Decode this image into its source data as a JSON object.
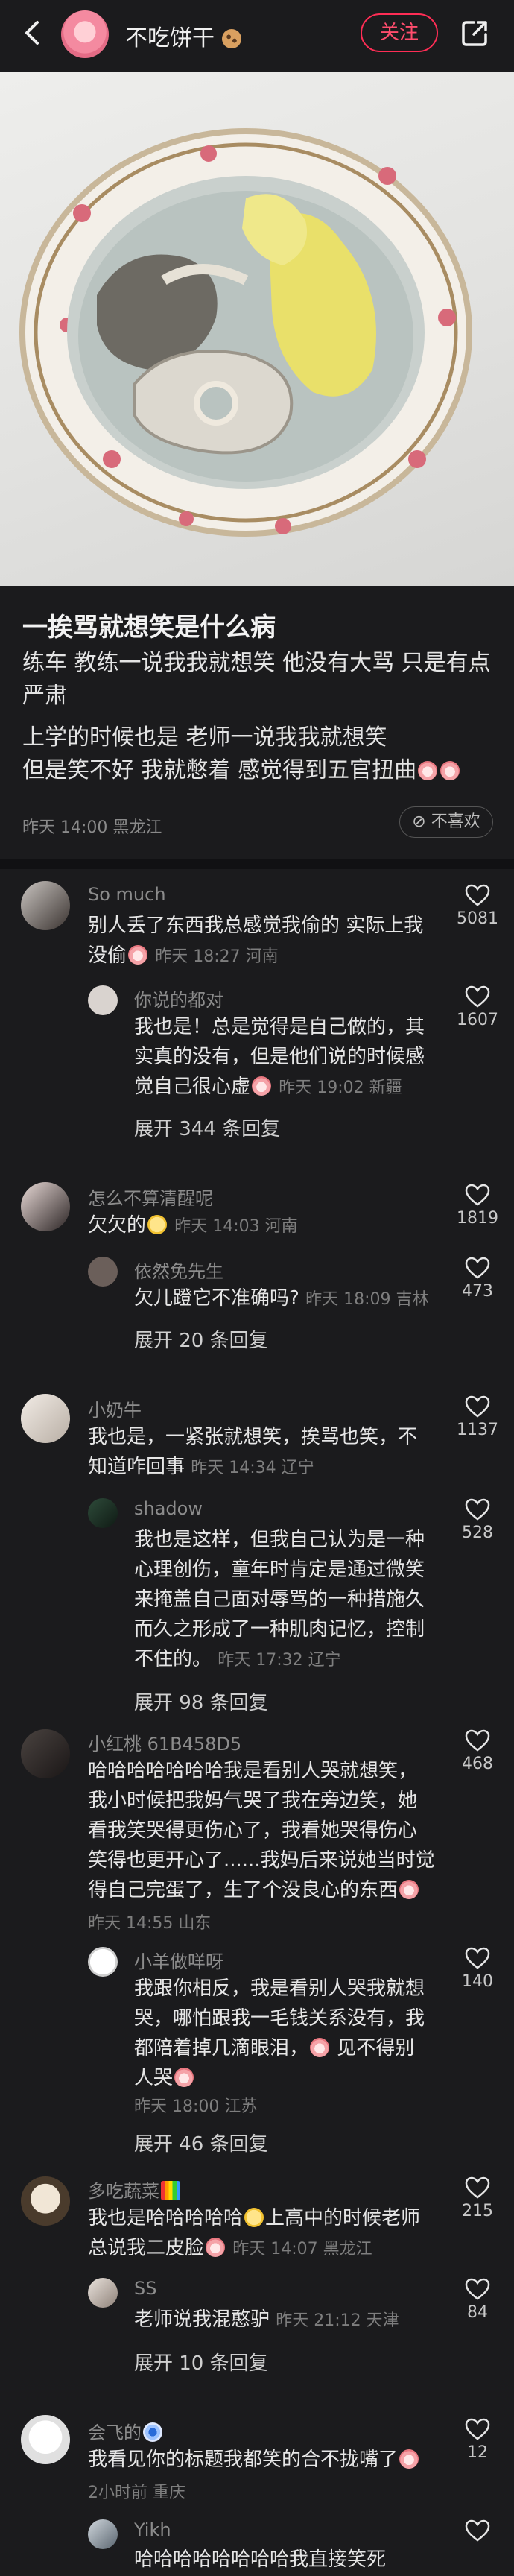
{
  "author": {
    "name": "不吃饼干"
  },
  "header": {
    "follow_label": "关注"
  },
  "post": {
    "title": "一挨骂就想笑是什么病",
    "lines": [
      "练车 教练一说我我就想笑 他没有大骂 只是有点",
      "严肃",
      "上学的时候也是 老师一说我我就想笑",
      "但是笑不好 我就憋着 感觉得到五官扭曲"
    ],
    "meta": "昨天 14:00 黑龙江",
    "dislike_label": "不喜欢"
  },
  "comments": [
    {
      "user": "So much",
      "lines": [
        "别人丢了东西我总感觉我偷的 实际上我",
        "没偷"
      ],
      "meta": "昨天 18:27 河南",
      "likes": "5081",
      "reply": {
        "user": "你说的都对",
        "lines": [
          "我也是！总是觉得是自己做的，其",
          "实真的没有，但是他们说的时候感",
          "觉自己很心虚"
        ],
        "meta": "昨天 19:02 新疆",
        "likes": "1607"
      },
      "expand": "展开 344 条回复"
    },
    {
      "user": "怎么不算清醒呢",
      "lines": [
        "欠欠的"
      ],
      "meta": "昨天 14:03 河南",
      "likes": "1819",
      "reply": {
        "user": "依然免先生",
        "lines": [
          "欠儿蹬它不准确吗?"
        ],
        "meta": "昨天 18:09 吉林",
        "likes": "473"
      },
      "expand": "展开 20 条回复"
    },
    {
      "user": "小奶牛",
      "lines": [
        "我也是，一紧张就想笑，挨骂也笑，不",
        "知道咋回事"
      ],
      "meta": "昨天 14:34 辽宁",
      "likes": "1137",
      "reply": {
        "user": "shadow",
        "lines": [
          "我也是这样，但我自己认为是一种",
          "心理创伤，童年时肯定是通过微笑",
          "来掩盖自己面对辱骂的一种措施久",
          "而久之形成了一种肌肉记忆，控制",
          "不住的。"
        ],
        "meta": "昨天 17:32 辽宁",
        "likes": "528"
      },
      "expand": "展开 98 条回复"
    },
    {
      "user": "小红桃 61B458D5",
      "lines": [
        "哈哈哈哈哈哈哈我是看别人哭就想笑，",
        "我小时候把我妈气哭了我在旁边笑，她",
        "看我笑哭得更伤心了，我看她哭得伤心",
        "笑得也更开心了......我妈后来说她当时觉",
        "得自己完蛋了，生了个没良心的东西"
      ],
      "meta": "昨天 14:55 山东",
      "likes": "468",
      "reply": {
        "user": "小羊做咩呀",
        "lines": [
          "我跟你相反，我是看别人哭我就想",
          "哭，哪怕跟我一毛钱关系没有，我",
          "都陪着掉几滴眼泪，",
          "人哭"
        ],
        "extra": "见不得别",
        "meta": "昨天 18:00 江苏",
        "likes": "140"
      },
      "expand": "展开 46 条回复"
    },
    {
      "user": "多吃蔬菜",
      "lines": [
        "我也是哈哈哈哈哈",
        "总说我二皮脸"
      ],
      "inline": "上高中的时候老师",
      "meta": "昨天 14:07 黑龙江",
      "likes": "215",
      "reply": {
        "user": "SS",
        "lines": [
          "老师说我混憨驴"
        ],
        "meta": "昨天 21:12 天津",
        "likes": "84"
      },
      "expand": "展开 10 条回复"
    },
    {
      "user": "会飞的",
      "lines": [
        "我看见你的标题我都笑的合不拢嘴了"
      ],
      "meta": "2小时前 重庆",
      "likes": "12",
      "reply": {
        "user": "Yikh",
        "lines": [
          "哈哈哈哈哈哈哈哈我直接笑死"
        ],
        "meta": "",
        "likes": ""
      }
    }
  ]
}
